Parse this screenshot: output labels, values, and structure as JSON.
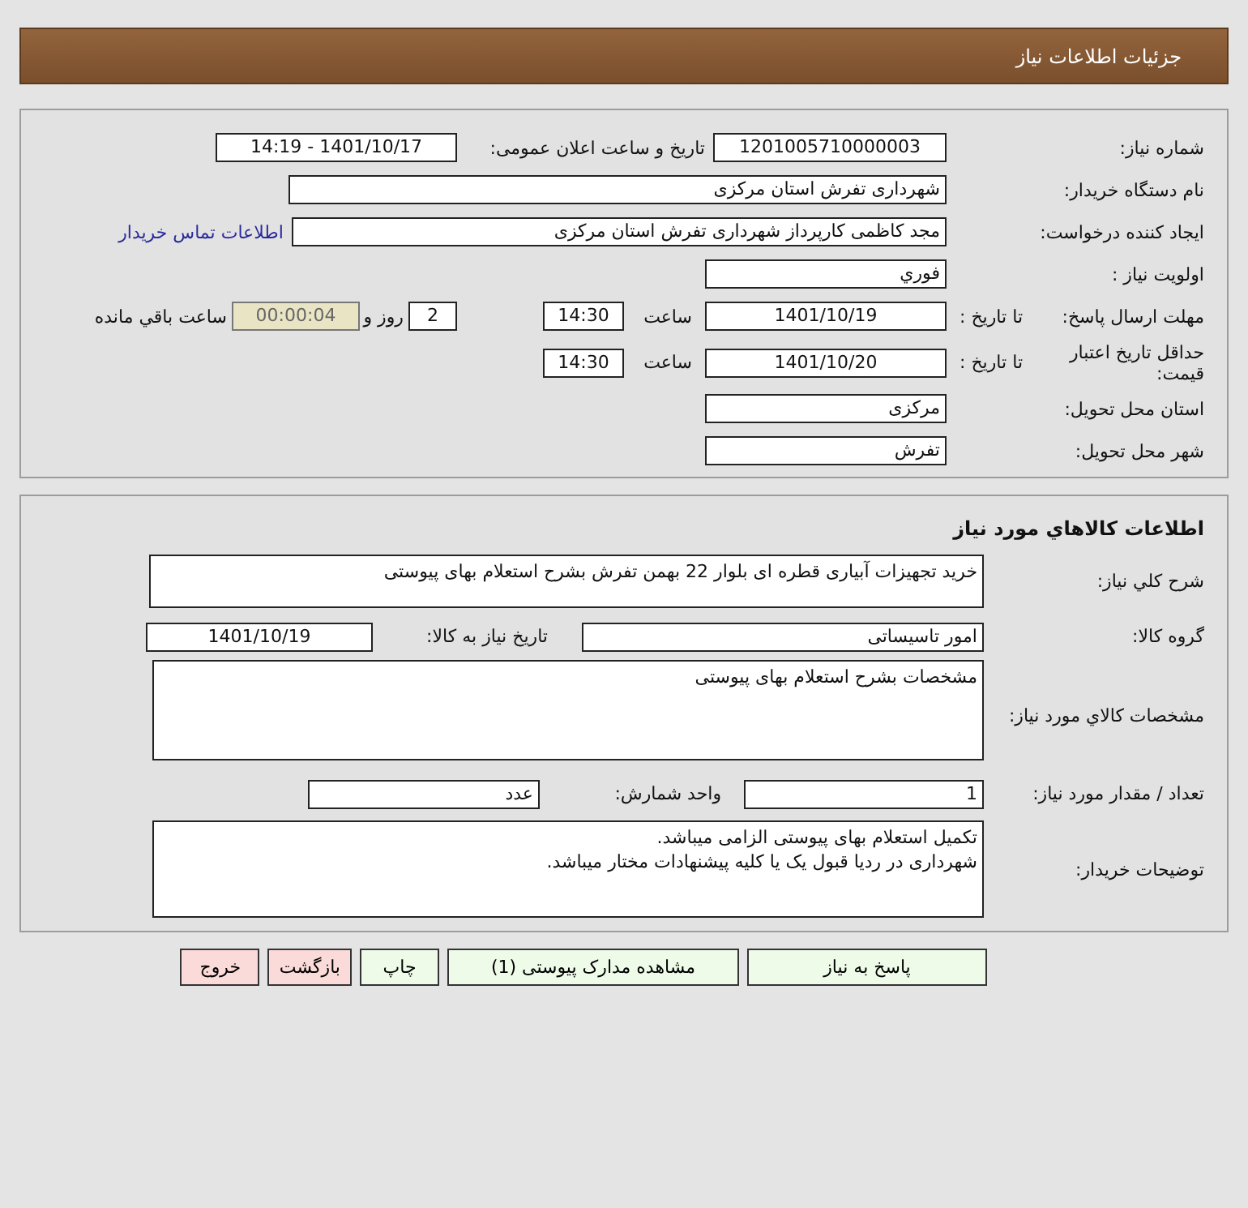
{
  "header": {
    "title": "جزئیات اطلاعات نیاز"
  },
  "need_info": {
    "need_number": {
      "label": "شماره نیاز:",
      "value": "1201005710000003"
    },
    "announce_datetime": {
      "label": "تاریخ و ساعت اعلان عمومی:",
      "value": "1401/10/17 - 14:19"
    },
    "buyer_org": {
      "label": "نام دستگاه خریدار:",
      "value": "شهرداری تفرش استان مرکزی"
    },
    "requester": {
      "label": "ایجاد کننده درخواست:",
      "value": "مجد کاظمی کارپرداز شهرداری تفرش استان مرکزی"
    },
    "buyer_contact_link": "اطلاعات تماس خریدار",
    "priority": {
      "label": "اولویت نیاز :",
      "value": "فوري"
    },
    "reply_deadline": {
      "label": "مهلت ارسال پاسخ:",
      "to_date_label": "تا تاریخ :",
      "date": "1401/10/19",
      "time_label": "ساعت",
      "time": "14:30",
      "days": "2",
      "days_label": "روز و",
      "countdown": "00:00:04",
      "remaining_label": "ساعت باقي مانده"
    },
    "price_validity": {
      "label": "حداقل تاریخ اعتبار قیمت:",
      "to_date_label": "تا تاریخ :",
      "date": "1401/10/20",
      "time_label": "ساعت",
      "time": "14:30"
    },
    "delivery_province": {
      "label": "استان محل تحویل:",
      "value": "مرکزی"
    },
    "delivery_city": {
      "label": "شهر محل تحویل:",
      "value": "تفرش"
    }
  },
  "goods_info": {
    "title": "اطلاعات كالاهاي مورد نياز",
    "general_description": {
      "label": "شرح كلي نياز:",
      "value": "خرید تجهیزات آبیاری قطره ای بلوار 22 بهمن تفرش بشرح استعلام بهای پیوستی"
    },
    "goods_group": {
      "label": "گروه کالا:",
      "value": "امور تاسیساتی"
    },
    "need_date": {
      "label": "تاریخ نیاز به کالا:",
      "value": "1401/10/19"
    },
    "specs": {
      "label": "مشخصات كالاي مورد نياز:",
      "value": "مشخصات بشرح استعلام بهای پیوستی"
    },
    "quantity": {
      "label": "تعداد / مقدار مورد نیاز:",
      "value": "1"
    },
    "unit": {
      "label": "واحد شمارش:",
      "value": "عدد"
    },
    "buyer_notes": {
      "label": "توضیحات خریدار:",
      "lines": [
        "تکمیل استعلام بهای پیوستی الزامی میباشد.",
        "شهرداری در ردیا قبول یک یا کلیه پیشنهادات مختار میباشد."
      ]
    }
  },
  "buttons": [
    {
      "label": "پاسخ به نیاز",
      "kind": "normal"
    },
    {
      "label": "مشاهده مدارک پیوستی (1)",
      "kind": "normal"
    },
    {
      "label": "چاپ",
      "kind": "normal"
    },
    {
      "label": "بازگشت",
      "kind": "exit"
    },
    {
      "label": "خروج",
      "kind": "exit"
    }
  ]
}
